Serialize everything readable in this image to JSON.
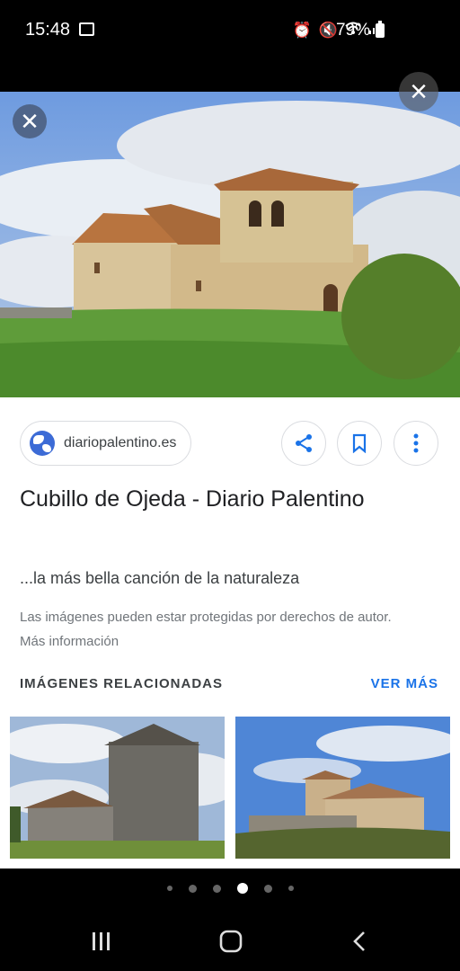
{
  "status_bar": {
    "time": "15:48",
    "battery": "79%",
    "icons": [
      "photo-icon",
      "alarm-icon",
      "mute-icon",
      "wifi-icon",
      "signal-icon",
      "battery-icon"
    ]
  },
  "viewer": {
    "close_icon": "close-icon",
    "source": "diariopalentino.es",
    "actions": [
      "share-icon",
      "bookmark-icon",
      "more-vert-icon"
    ],
    "title": "Cubillo de Ojeda - Diario Palentino",
    "snippet": "...la más bella canción de la naturaleza",
    "copyright": "Las imágenes pueden estar protegidas por derechos de autor. Más información",
    "related_heading": "IMÁGENES RELACIONADAS",
    "see_more": "VER MÁS"
  },
  "colors": {
    "accent": "#1a73e8",
    "text_primary": "#202124",
    "text_secondary": "#70757a"
  },
  "pagination": {
    "count": 6,
    "active_index": 3
  },
  "nav_bar": [
    "recents-icon",
    "home-icon",
    "back-icon"
  ]
}
